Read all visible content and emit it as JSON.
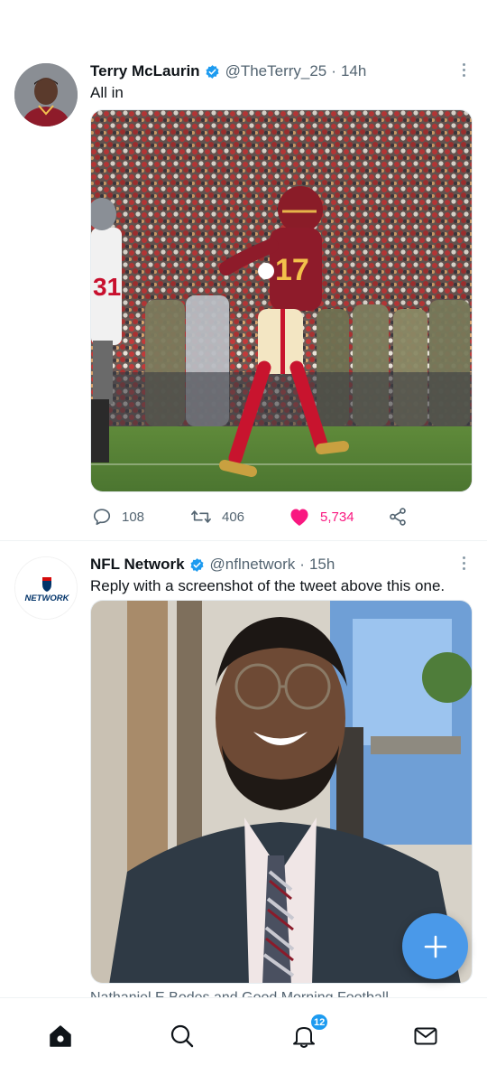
{
  "colors": {
    "accent": "#1d9bf0",
    "fab": "#4a99e9",
    "like_active": "#f91880",
    "secondary_text": "#536471",
    "primary_text": "#0f1419"
  },
  "tweets": [
    {
      "display_name": "Terry McLaurin",
      "verified": true,
      "handle": "@TheTerry_25",
      "separator": "·",
      "time": "14h",
      "text": "All in",
      "media_description": "Washington player #17 in burgundy jersey celebrating on the field in front of a stadium crowd",
      "replies": "108",
      "retweets": "406",
      "likes": "5,734",
      "liked": true
    },
    {
      "display_name": "NFL Network",
      "verified": true,
      "handle": "@nflnetwork",
      "separator": "·",
      "time": "15h",
      "text": "Reply with a screenshot of the tweet above this one.",
      "media_description": "Smiling man with glasses and a beard in a suit and striped tie looking upward in a TV studio",
      "peek_text": "Nathaniel E Bodes and Good Morning Football"
    }
  ],
  "avatar_label_nfl": "NETWORK",
  "jersey_number": "17",
  "bottom_nav": {
    "items": [
      {
        "name": "home-icon",
        "active": true
      },
      {
        "name": "search-icon",
        "active": false
      },
      {
        "name": "notifications-icon",
        "active": false
      },
      {
        "name": "messages-icon",
        "active": false
      }
    ],
    "notification_badge": "12"
  },
  "fab_icon": "plus-icon"
}
